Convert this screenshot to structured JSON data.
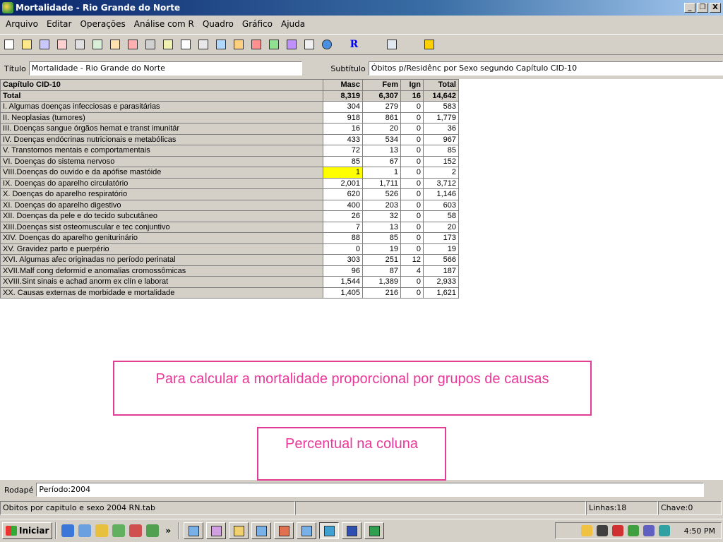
{
  "window": {
    "title": "Mortalidade - Rio Grande do Norte",
    "buttons": [
      "_",
      "̅",
      "X"
    ]
  },
  "menu": [
    "Arquivo",
    "Editar",
    "Operações",
    "Análise com R",
    "Quadro",
    "Gráfico",
    "Ajuda"
  ],
  "toolbar": {
    "r_label": "R"
  },
  "fields": {
    "titulo_label": "Título",
    "titulo_value": "Mortalidade - Rio Grande do Norte",
    "subtitulo_label": "Subtítulo",
    "subtitulo_value": "Óbitos p/Residênc por Sexo segundo Capítulo CID-10"
  },
  "table": {
    "headers": [
      "Capítulo CID-10",
      "Masc",
      "Fem",
      "Ign",
      "Total"
    ],
    "total": [
      "Total",
      "8,319",
      "6,307",
      "16",
      "14,642"
    ],
    "rows": [
      [
        "I.   Algumas doenças infecciosas e parasitárias",
        "304",
        "279",
        "0",
        "583"
      ],
      [
        "II.  Neoplasias (tumores)",
        "918",
        "861",
        "0",
        "1,779"
      ],
      [
        "III. Doenças sangue órgãos hemat e transt imunitár",
        "16",
        "20",
        "0",
        "36"
      ],
      [
        "IV.  Doenças endócrinas nutricionais e metabólicas",
        "433",
        "534",
        "0",
        "967"
      ],
      [
        "V.   Transtornos mentais e comportamentais",
        "72",
        "13",
        "0",
        "85"
      ],
      [
        "VI.  Doenças do sistema nervoso",
        "85",
        "67",
        "0",
        "152"
      ],
      [
        "VIII.Doenças do ouvido e da apófise mastóide",
        "1",
        "1",
        "0",
        "2"
      ],
      [
        "IX.  Doenças do aparelho circulatório",
        "2,001",
        "1,711",
        "0",
        "3,712"
      ],
      [
        "X.   Doenças do aparelho respiratório",
        "620",
        "526",
        "0",
        "1,146"
      ],
      [
        "XI.  Doenças do aparelho digestivo",
        "400",
        "203",
        "0",
        "603"
      ],
      [
        "XII. Doenças da pele e do tecido subcutâneo",
        "26",
        "32",
        "0",
        "58"
      ],
      [
        "XIII.Doenças sist osteomuscular e tec conjuntivo",
        "7",
        "13",
        "0",
        "20"
      ],
      [
        "XIV. Doenças do aparelho geniturinário",
        "88",
        "85",
        "0",
        "173"
      ],
      [
        "XV.  Gravidez parto e puerpério",
        "0",
        "19",
        "0",
        "19"
      ],
      [
        "XVI. Algumas afec originadas no período perinatal",
        "303",
        "251",
        "12",
        "566"
      ],
      [
        "XVII.Malf cong deformid e anomalias cromossômicas",
        "96",
        "87",
        "4",
        "187"
      ],
      [
        "XVIII.Sint sinais e achad anorm ex clín e laborat",
        "1,544",
        "1,389",
        "0",
        "2,933"
      ],
      [
        "XX.  Causas externas de morbidade e mortalidade",
        "1,405",
        "216",
        "0",
        "1,621"
      ]
    ]
  },
  "annotations": {
    "box1": "Para calcular a mortalidade proporcional por grupos de causas",
    "box2": "Percentual na coluna"
  },
  "footer": {
    "rodape_label": "Rodapé",
    "rodape_value": "Período:2004"
  },
  "status": {
    "file": "Obitos por capitulo e sexo 2004 RN.tab",
    "linhas": "Linhas:18",
    "chave": "Chave:0"
  },
  "taskbar": {
    "start_label": "Iniciar",
    "chevron": "»",
    "clock": "4:50 PM"
  }
}
